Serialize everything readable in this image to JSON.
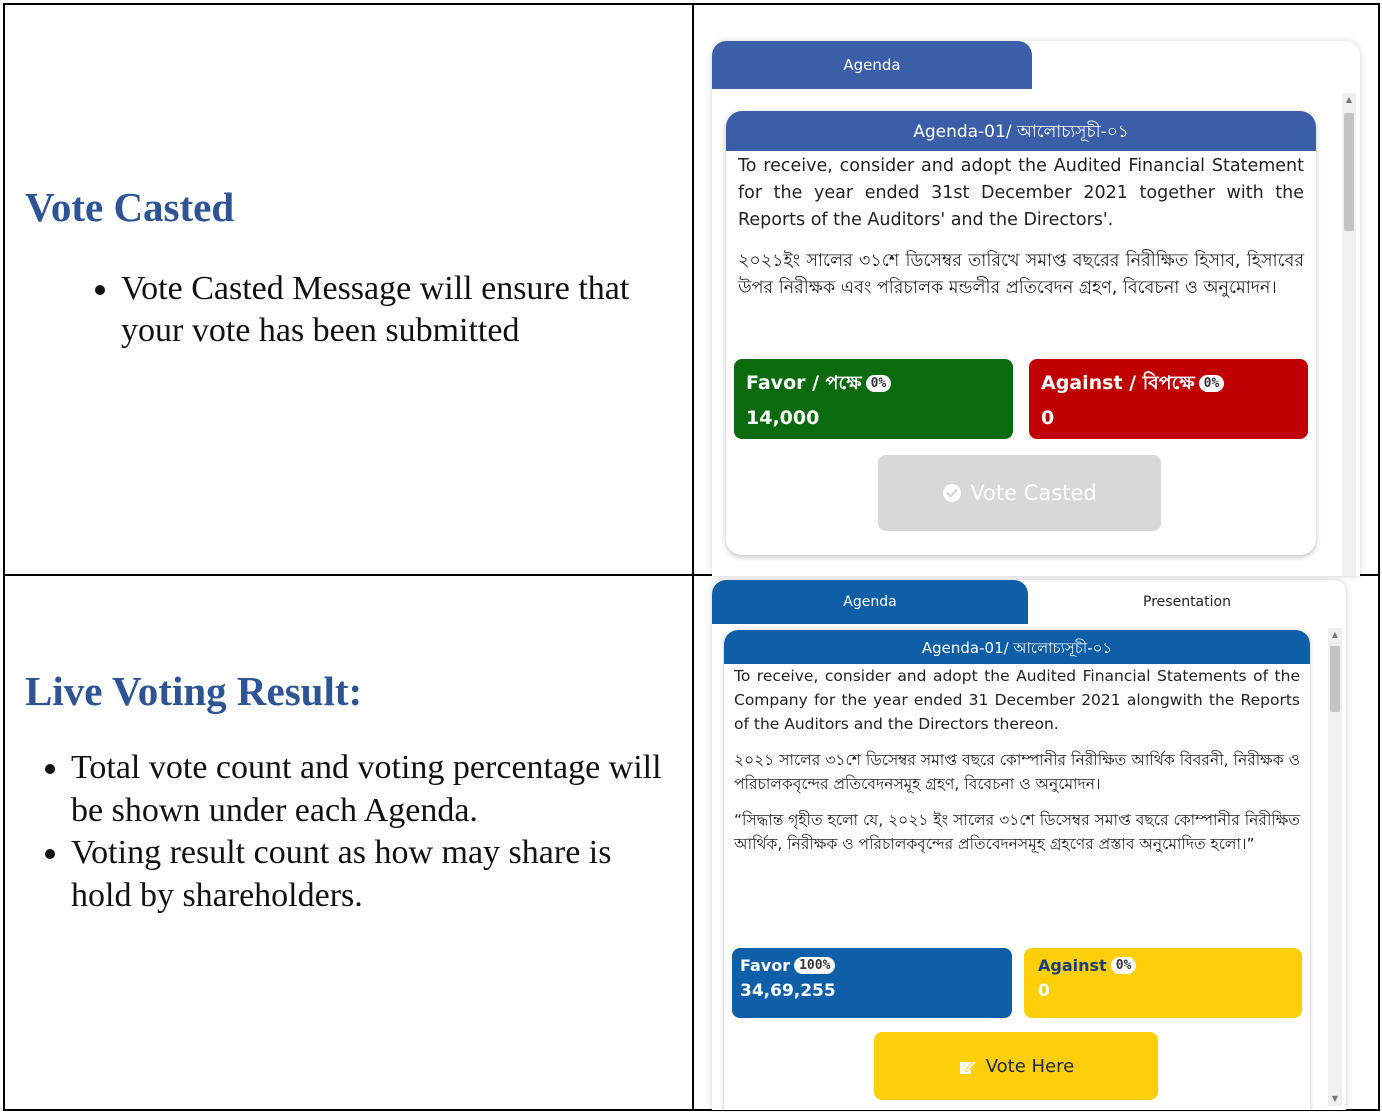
{
  "section1": {
    "heading": "Vote Casted",
    "bullets": [
      "Vote Casted Message will ensure that your vote has been submitted"
    ],
    "app": {
      "tabs": [
        "Agenda"
      ],
      "card_title": "Agenda-01/ আলোচ্যসূচী-০১",
      "para_en": "To receive, consider and adopt the Audited Financial Statement for the year ended 31st December 2021 together with the Reports of the Auditors' and the Directors'.",
      "para_bn": "২০২১ইং সালের ৩১শে ডিসেম্বর তারিখে সমাপ্ত বছরের নিরীক্ষিত হিসাব, হিসাবের উপর নিরীক্ষক এবং পরিচালক মন্ডলীর প্রতিবেদন গ্রহণ, বিবেচনা ও অনুমোদন।",
      "favor": {
        "label": "Favor / পক্ষে",
        "percent": "0%",
        "count": "14,000"
      },
      "against": {
        "label": "Against / বিপক্ষে",
        "percent": "0%",
        "count": "0"
      },
      "button": "Vote Casted",
      "colors": {
        "favor": "#0a6b0e",
        "against": "#c00000",
        "header": "#3a5fa8",
        "button": "#d8d8d8"
      }
    }
  },
  "section2": {
    "heading": "Live Voting Result:",
    "bullets": [
      "Total vote count and voting percentage will be shown under each Agenda.",
      "Voting result count as how may share is hold by shareholders."
    ],
    "app": {
      "tabs": [
        "Agenda",
        "Presentation"
      ],
      "card_title": "Agenda-01/ আলোচ্যসূচী-০১",
      "para_en": "To receive, consider and adopt the Audited Financial Statements of the Company for the year ended 31 December 2021 alongwith the Reports of the Auditors and the Directors thereon.",
      "para_bn": "২০২১ সালের ৩১শে ডিসেম্বর সমাপ্ত বছরে কোম্পানীর নিরীক্ষিত আর্থিক বিবরনী, নিরীক্ষক ও পরিচালকবৃন্দের প্রতিবেদনসমূহ গ্রহণ, বিবেচনা ও অনুমোদন।",
      "para_res": "“সিদ্ধান্ত গৃহীত হলো যে, ২০২১ ইং সালের ৩১শে ডিসেম্বর সমাপ্ত বছরে কোম্পানীর নিরীক্ষিত আর্থিক, নিরীক্ষক ও পরিচালকবৃন্দের প্রতিবেদনসমূহ গ্রহণের প্রস্তাব অনুমোদিত হলো।”",
      "favor": {
        "label": "Favor",
        "percent": "100%",
        "count": "34,69,255"
      },
      "against": {
        "label": "Against",
        "percent": "0%",
        "count": "0"
      },
      "button": "Vote Here",
      "colors": {
        "favor": "#0f5fa8",
        "against": "#fccf0a",
        "header": "#0f5fa8",
        "button": "#fccf0a"
      }
    }
  }
}
